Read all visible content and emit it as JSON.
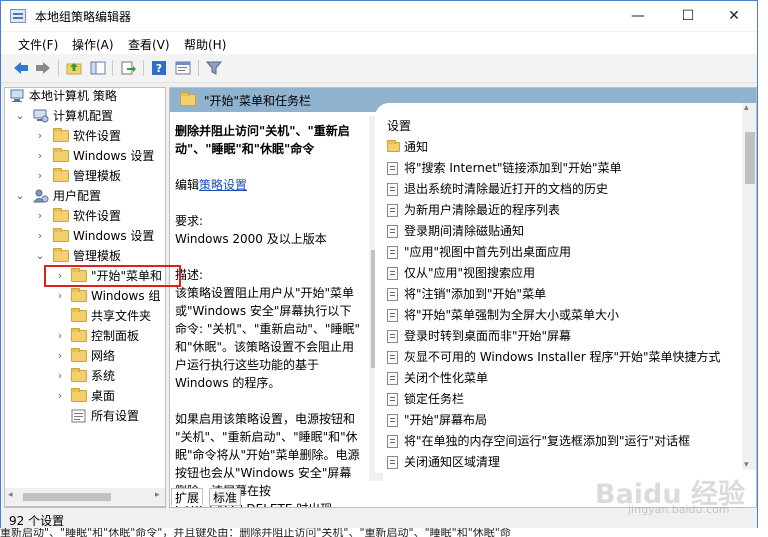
{
  "window": {
    "title": "本地组策略编辑器",
    "minimize": "—",
    "maximize": "☐",
    "close": "✕"
  },
  "menu": [
    "文件(F)",
    "操作(A)",
    "查看(V)",
    "帮助(H)"
  ],
  "toolbar": [
    "back-icon",
    "forward-icon",
    "up-folder-icon",
    "show-tree-icon",
    "export-icon",
    "help-icon",
    "properties-icon",
    "filter-icon"
  ],
  "tree": {
    "root": "本地计算机 策略",
    "items": [
      {
        "label": "计算机配置",
        "level": 1,
        "expanded": true
      },
      {
        "label": "软件设置",
        "level": 2
      },
      {
        "label": "Windows 设置",
        "level": 2
      },
      {
        "label": "管理模板",
        "level": 2
      },
      {
        "label": "用户配置",
        "level": 1,
        "expanded": true
      },
      {
        "label": "软件设置",
        "level": 2
      },
      {
        "label": "Windows 设置",
        "level": 2
      },
      {
        "label": "管理模板",
        "level": 2,
        "expanded": true
      },
      {
        "label": "\"开始\"菜单和",
        "level": 3,
        "selected": true
      },
      {
        "label": "Windows 组",
        "level": 3
      },
      {
        "label": "共享文件夹",
        "level": 3
      },
      {
        "label": "控制面板",
        "level": 3
      },
      {
        "label": "网络",
        "level": 3
      },
      {
        "label": "系统",
        "level": 3
      },
      {
        "label": "桌面",
        "level": 3
      },
      {
        "label": "所有设置",
        "level": 3
      }
    ]
  },
  "panel": {
    "header": "\"开始\"菜单和任务栏",
    "description": {
      "title_line1": "删除并阻止访问\"关机\"、\"重新启",
      "title_line2": "动\"、\"睡眠\"和\"休眠\"命令",
      "edit_prefix": "编辑",
      "edit_link": "策略设置",
      "req_label": "要求:",
      "req_value": "Windows 2000 及以上版本",
      "desc_label": "描述:",
      "desc_lines": [
        "该策略设置阻止用户从\"开始\"菜单",
        "或\"Windows 安全\"屏幕执行以下",
        "命令: \"关机\"、\"重新启动\"、\"睡眠\"",
        "和\"休眠\"。该策略设置不会阻止用",
        "户运行执行这些功能的基于",
        "Windows 的程序。"
      ],
      "para2_lines": [
        "如果启用该策略设置，电源按钮和",
        "\"关机\"、\"重新启动\"、\"睡眠\"和\"休",
        "眠\"命令将从\"开始\"菜单删除。电源",
        "按钮也会从\"Windows 安全\"屏幕",
        "删除，该屏幕在按",
        "CTRL+ALT+DELETE 时出现。"
      ]
    },
    "settings_header": "设置",
    "folder_item": "通知",
    "settings": [
      "将\"搜索 Internet\"链接添加到\"开始\"菜单",
      "退出系统时清除最近打开的文档的历史",
      "为新用户清除最近的程序列表",
      "登录期间清除磁贴通知",
      "\"应用\"视图中首先列出桌面应用",
      "仅从\"应用\"视图搜索应用",
      "将\"注销\"添加到\"开始\"菜单",
      "将\"开始\"菜单强制为全屏大小或菜单大小",
      "登录时转到桌面而非\"开始\"屏幕",
      "灰显不可用的 Windows Installer 程序\"开始\"菜单快捷方式",
      "关闭个性化菜单",
      "锁定任务栏",
      "\"开始\"屏幕布局",
      "将\"在单独的内存空间运行\"复选框添加到\"运行\"对话框",
      "关闭通知区域清理"
    ]
  },
  "tabs": [
    "扩展",
    "标准"
  ],
  "status": "92 个设置",
  "behind_text": "重新启动\"、\"睡眠\"和\"休眠\"命令\"，并且键处由：删除并阻止访问\"关机\"、\"重新启动\"、\"睡眠\"和\"休眠\"命",
  "watermark": {
    "main": "Baidu 经验",
    "sub": "jingyan.baidu.com"
  },
  "colors": {
    "panel_header": "#8fb2cf",
    "highlight": "#e02020",
    "link": "#1a4fb5"
  }
}
